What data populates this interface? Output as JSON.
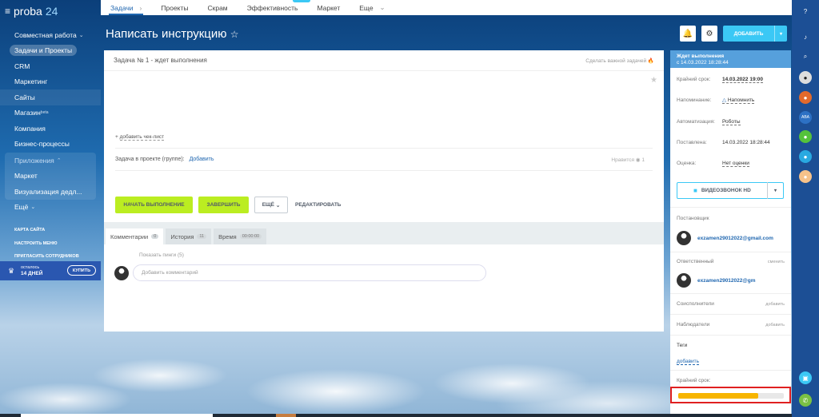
{
  "portal": {
    "name": "proba",
    "number": "24"
  },
  "menu": {
    "items": [
      {
        "label": "Совместная работа",
        "chevron": true
      },
      {
        "label": "Задачи и Проекты",
        "active": true
      },
      {
        "label": "CRM"
      },
      {
        "label": "Маркетинг"
      },
      {
        "label": "Сайты"
      },
      {
        "label": "Магазин",
        "sup": "beta"
      },
      {
        "label": "Компания"
      },
      {
        "label": "Бизнес-процессы"
      }
    ],
    "apps": {
      "label": "Приложения",
      "sub": [
        "Маркет",
        "Визуализация дедл..."
      ]
    },
    "more": "Ещё"
  },
  "links": [
    "КАРТА САЙТА",
    "НАСТРОИТЬ МЕНЮ",
    "ПРИГЛАСИТЬ СОТРУДНИКОВ"
  ],
  "trial": {
    "line1": "осталось",
    "line2": "14 ДНЕЙ",
    "buy": "КУПИТЬ"
  },
  "topnav": {
    "tabs": [
      "Задачи",
      "Проекты",
      "Скрам",
      "Эффективность",
      "Маркет",
      "Еще"
    ]
  },
  "header": {
    "title": "Написать инструкцию",
    "add": "ДОБАВИТЬ"
  },
  "task": {
    "status_line": "Задача № 1 - ждет выполнения",
    "important": "Сделать важной задачей",
    "checklist": "добавить чек-лист",
    "project_label": "Задача в проекте (группе):",
    "project_add": "Добавить",
    "likes": "Нравится",
    "likes_count": "1",
    "btn_start": "НАЧАТЬ ВЫПОЛНЕНИЕ",
    "btn_finish": "ЗАВЕРШИТЬ",
    "btn_more": "ЕЩЁ",
    "btn_edit": "РЕДАКТИРОВАТЬ"
  },
  "comments": {
    "tabs": [
      {
        "label": "Комментарии",
        "count": "0"
      },
      {
        "label": "История",
        "count": "11"
      },
      {
        "label": "Время",
        "count": "00:00:00"
      }
    ],
    "show_more": "Показать пинги (5)",
    "placeholder": "Добавить комментарий"
  },
  "side": {
    "status_title": "Ждет выполнения",
    "status_since": "с 14.03.2022 18:28:44",
    "deadline_label": "Крайний срок:",
    "deadline_value": "14.03.2022 19:00",
    "reminder_label": "Напоминание:",
    "reminder_value": "Напомнить",
    "automation_label": "Автоматизация:",
    "automation_value": "Роботы",
    "created_label": "Поставлена:",
    "created_value": "14.03.2022 18:28:44",
    "rating_label": "Оценка:",
    "rating_value": "Нет оценки",
    "video_call": "ВИДЕОЗВОНОК HD",
    "creator_label": "Постановщик",
    "creator_email": "exzamen29012022@gmail.com",
    "responsible_label": "Ответственный",
    "responsible_change": "сменить",
    "responsible_email": "exzamen29012022@gm",
    "coexec_label": "Соисполнители",
    "coexec_add": "добавить",
    "observers_label": "Наблюдатели",
    "observers_add": "добавить",
    "tags_label": "Теги",
    "tags_add": "добавить",
    "deadline2_label": "Крайний срок:",
    "deadline_progress": 0.76
  },
  "colors": {
    "accent": "#3bc8f5",
    "green_btn": "#bbed21",
    "progress": "#f7b500",
    "highlight": "#e02020"
  }
}
